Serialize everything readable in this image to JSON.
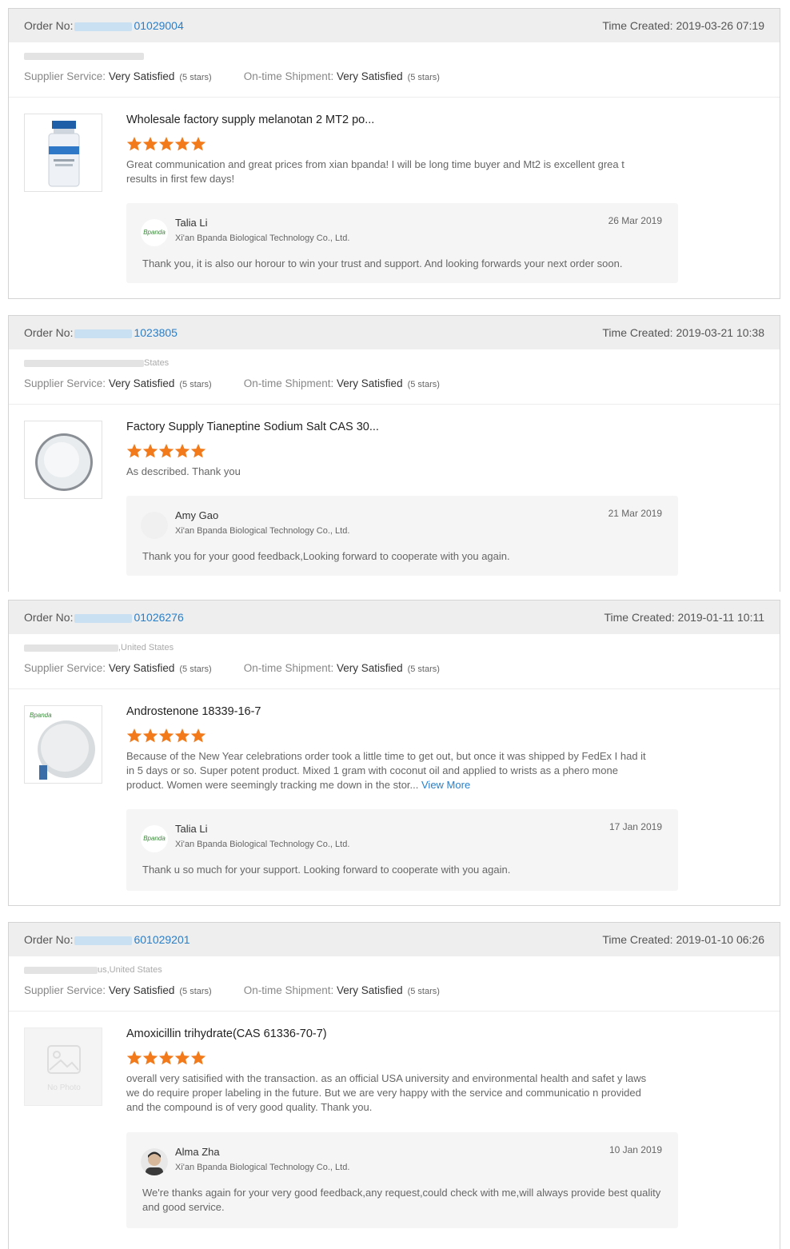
{
  "colors": {
    "star": "#f27a1a",
    "link": "#2a7fc9",
    "header_bg": "#eeeeee"
  },
  "reviews": [
    {
      "order_label": "Order No:",
      "order_num": "01029004",
      "created": "Time Created: 2019-03-26 07:19",
      "location": "",
      "supplier_label": "Supplier Service:",
      "supplier_value": "Very Satisfied",
      "supplier_stars": "(5 stars)",
      "shipment_label": "On-time Shipment:",
      "shipment_value": "Very Satisfied",
      "shipment_stars": "(5 stars)",
      "product": "Wholesale factory supply melanotan 2 MT2 po...",
      "rating": 5,
      "text": "Great communication and great prices from xian bpanda! I will be long time buyer and Mt2 is excellent grea t results in first few days!",
      "more": "",
      "reply_name": "Talia Li",
      "reply_company": "Xi'an Bpanda Biological Technology Co., Ltd.",
      "reply_date": "26 Mar 2019",
      "reply_text": "Thank you, it is also our horour to win your trust and support. And looking forwards your next order soon.",
      "avatar_text": "Bpanda"
    },
    {
      "order_label": "Order No:",
      "order_num": "1023805",
      "created": "Time Created: 2019-03-21 10:38",
      "location": "States",
      "supplier_label": "Supplier Service:",
      "supplier_value": "Very Satisfied",
      "supplier_stars": "(5 stars)",
      "shipment_label": "On-time Shipment:",
      "shipment_value": "Very Satisfied",
      "shipment_stars": "(5 stars)",
      "product": "Factory Supply Tianeptine Sodium Salt CAS 30...",
      "rating": 5,
      "text": "As described. Thank you",
      "more": "",
      "reply_name": "Amy Gao",
      "reply_company": "Xi'an Bpanda Biological Technology Co., Ltd.",
      "reply_date": "21 Mar 2019",
      "reply_text": "Thank you for your good feedback,Looking forward to cooperate with you again.",
      "avatar_text": ""
    },
    {
      "order_label": "Order No:",
      "order_num": "01026276",
      "created": "Time Created: 2019-01-11 10:11",
      "location": ",United States",
      "supplier_label": "Supplier Service:",
      "supplier_value": "Very Satisfied",
      "supplier_stars": "(5 stars)",
      "shipment_label": "On-time Shipment:",
      "shipment_value": "Very Satisfied",
      "shipment_stars": "(5 stars)",
      "product": "Androstenone 18339-16-7",
      "rating": 5,
      "text": "Because of the New Year celebrations order took a little time to get out, but once it was shipped by FedEx I had it in 5 days or so. Super potent product. Mixed 1 gram with coconut oil and applied to wrists as a phero mone product. Women were seemingly tracking me down in the stor...",
      "more": "View More",
      "reply_name": "Talia Li",
      "reply_company": "Xi'an Bpanda Biological Technology Co., Ltd.",
      "reply_date": "17 Jan 2019",
      "reply_text": "Thank u so much for your support. Looking forward to cooperate with you again.",
      "avatar_text": "Bpanda"
    },
    {
      "order_label": "Order No:",
      "order_num": "601029201",
      "created": "Time Created: 2019-01-10 06:26",
      "location": "us,United States",
      "supplier_label": "Supplier Service:",
      "supplier_value": "Very Satisfied",
      "supplier_stars": "(5 stars)",
      "shipment_label": "On-time Shipment:",
      "shipment_value": "Very Satisfied",
      "shipment_stars": "(5 stars)",
      "product": "Amoxicillin trihydrate(CAS 61336-70-7)",
      "rating": 5,
      "text": "overall very satisified with the transaction. as an official USA university and environmental health and safet y laws we do require proper labeling in the future. But we are very happy with the service and communicatio n provided and the compound is of very good quality. Thank you.",
      "more": "",
      "reply_name": "Alma Zha",
      "reply_company": "Xi'an Bpanda Biological Technology Co., Ltd.",
      "reply_date": "10 Jan 2019",
      "reply_text": "We're thanks again for your very good feedback,any request,could check with me,will always provide best quality and good service.",
      "avatar_text": "",
      "no_photo": "No Photo"
    }
  ]
}
